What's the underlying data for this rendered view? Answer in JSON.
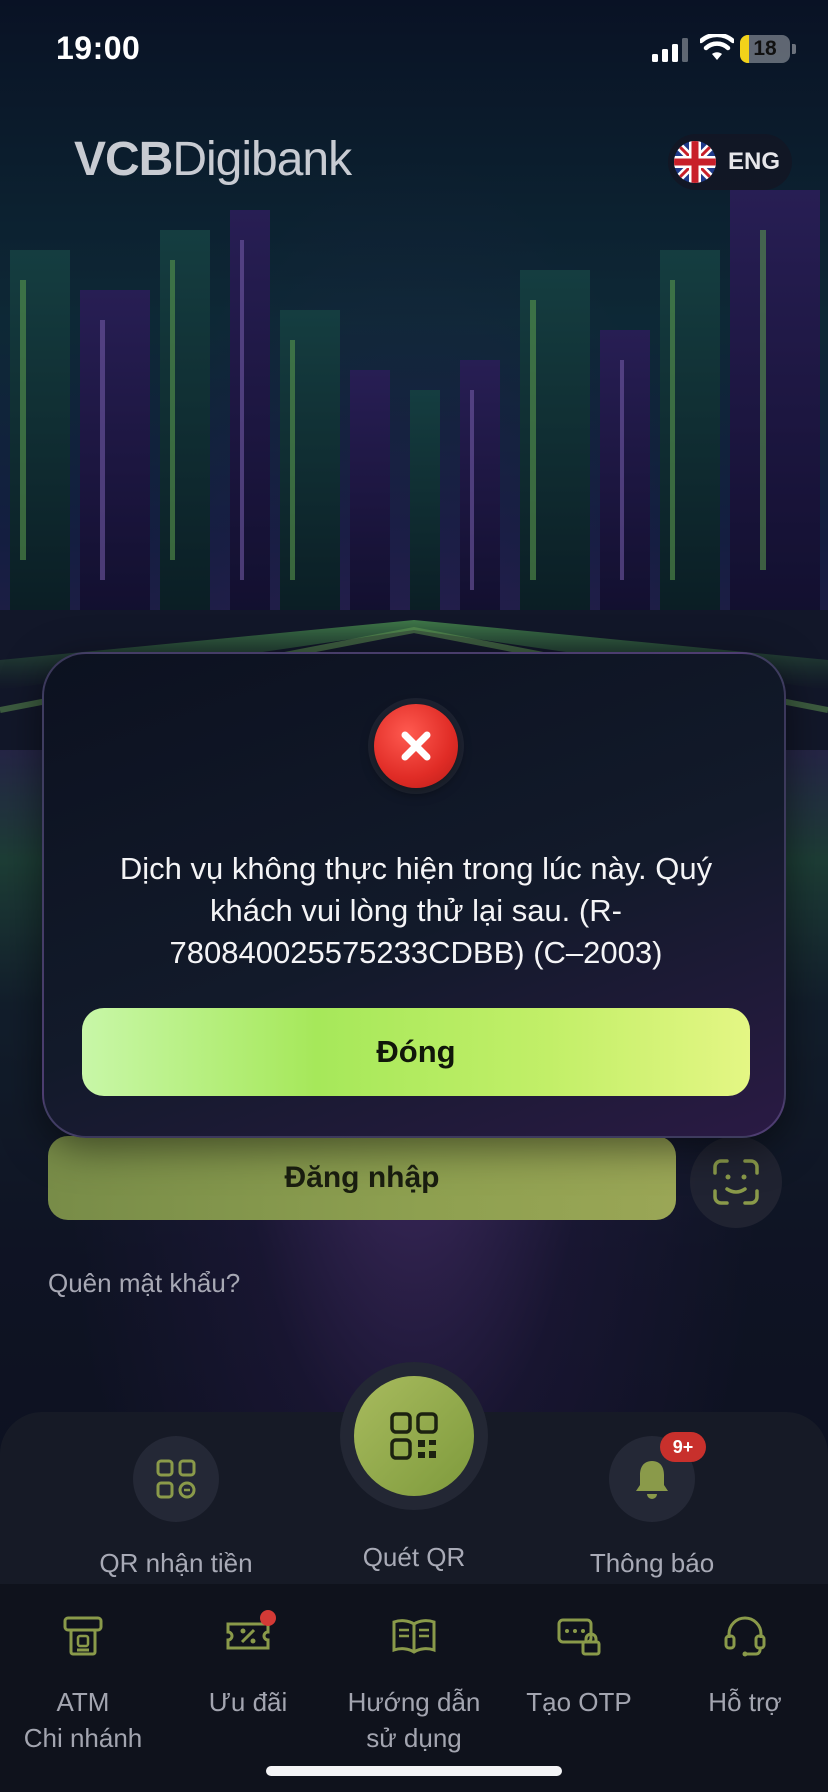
{
  "status_bar": {
    "time": "19:00",
    "battery": "18",
    "battery_level": 0.18
  },
  "header": {
    "logo_bold": "VCB",
    "logo_light": "Digibank",
    "language": "ENG"
  },
  "dialog": {
    "message": "Dịch vụ không thực hiện trong lúc này. Quý khách vui lòng thử lại sau. (R-780840025575233CDBB) (C–2003)",
    "close_label": "Đóng"
  },
  "login": {
    "button_label": "Đăng nhập",
    "forgot_password": "Quên mật khẩu?"
  },
  "quick_actions": {
    "qr_receive": "QR nhận tiền",
    "scan_qr": "Quét QR",
    "notifications": "Thông báo",
    "notification_badge": "9+"
  },
  "bottom_nav": {
    "atm_line1": "ATM",
    "atm_line2": "Chi nhánh",
    "offers": "Ưu đãi",
    "guide_line1": "Hướng dẫn",
    "guide_line2": "sử dụng",
    "otp": "Tạo OTP",
    "support": "Hỗ trợ"
  },
  "colors": {
    "accent_green": "#a6e85a",
    "error_red": "#e02c26",
    "badge_red": "#c8302c"
  }
}
